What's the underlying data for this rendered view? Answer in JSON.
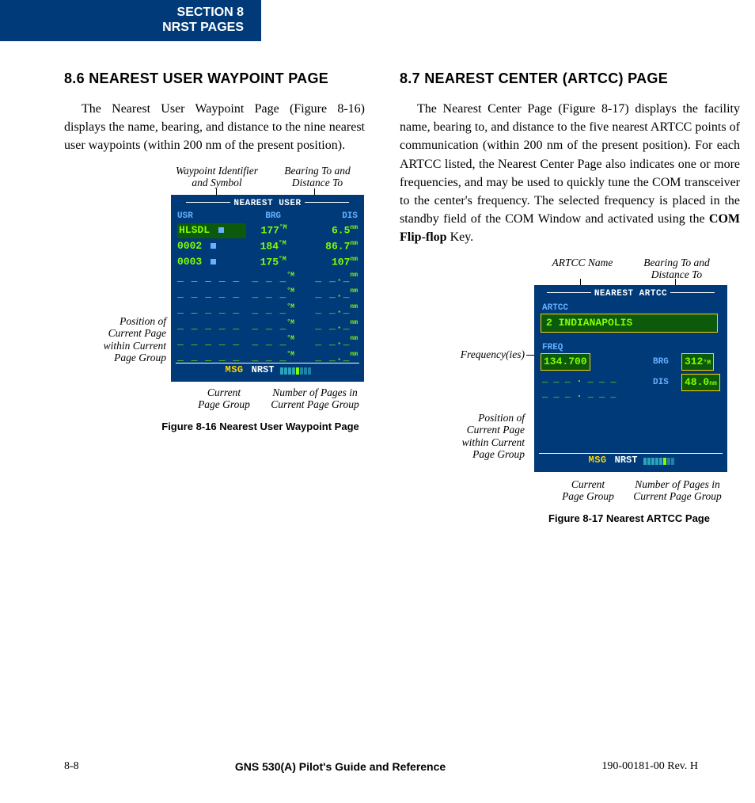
{
  "section_tab": {
    "line1": "SECTION 8",
    "line2": "NRST PAGES"
  },
  "col1": {
    "heading": "8.6  NEAREST USER WAYPOINT PAGE",
    "para": "The Nearest User Waypoint Page (Figure 8-16) displays the name, bearing, and distance to the nine nearest user waypoints (within 200 nm of the present position)."
  },
  "col2": {
    "heading": "8.7  NEAREST CENTER (ARTCC) PAGE",
    "para_a": "The Nearest Center Page (Figure 8-17) displays the facility name, bearing to, and distance to the five nearest ARTCC points of communication (within 200 nm of the present position).  For each ARTCC listed, the Nearest Center Page also indicates one or more frequencies, and may be used to quickly tune the COM transceiver to the center's frequency.  The selected frequency is placed in the standby field of the COM Window and activated using the ",
    "para_b_bold": "COM Flip-flop",
    "para_c": " Key."
  },
  "fig16": {
    "callouts": {
      "wpident": "Waypoint Identifier and Symbol",
      "brgdis": "Bearing To and Distance To",
      "pos_a": "Position of",
      "pos_b": "Current Page",
      "pos_c": "within Current",
      "pos_d": "Page Group",
      "cpg_a": "Current",
      "cpg_b": "Page Group",
      "npg_a": "Number of Pages in",
      "npg_b": "Current Page Group"
    },
    "gps": {
      "title": "NEAREST USER",
      "hdr_usr": "USR",
      "hdr_brg": "BRG",
      "hdr_dis": "DIS",
      "rows": [
        {
          "id": "HLSDL",
          "brg": "177",
          "brg_suf": "°M",
          "dis": "6.5",
          "dis_suf": "nm",
          "hl": true
        },
        {
          "id": "0002",
          "brg": "184",
          "brg_suf": "°M",
          "dis": "86.7",
          "dis_suf": "nm"
        },
        {
          "id": "0003",
          "brg": "175",
          "brg_suf": "°M",
          "dis": "107",
          "dis_suf": "nm"
        }
      ],
      "empty_id": "_ _ _ _ _",
      "empty_brg": "_ _ _",
      "empty_brg_suf": "°M",
      "empty_dis": "_ _._",
      "empty_dis_suf": "nm",
      "msg": "MSG",
      "nrst": "NRST"
    },
    "caption": "Figure 8-16  Nearest User Waypoint Page"
  },
  "fig17": {
    "callouts": {
      "artcc_name": "ARTCC Name",
      "brgdis": "Bearing To and Distance To",
      "freq": "Frequency(ies)",
      "pos_a": "Position of",
      "pos_b": "Current Page",
      "pos_c": "within Current",
      "pos_d": "Page Group",
      "cpg_a": "Current",
      "cpg_b": "Page Group",
      "npg_a": "Number of Pages in",
      "npg_b": "Current Page Group"
    },
    "gps": {
      "title": "NEAREST ARTCC",
      "artcc_lbl": "ARTCC",
      "artcc_name": "2 INDIANAPOLIS",
      "freq_lbl": "FREQ",
      "freq_val": "134.700",
      "freq_blank": "_ _ _ . _ _ _",
      "brg_lbl": "BRG",
      "brg_val": "312",
      "brg_suf": "°M",
      "dis_lbl": "DIS",
      "dis_val": "48.0",
      "dis_suf": "nm",
      "msg": "MSG",
      "nrst": "NRST"
    },
    "caption": "Figure 8-17  Nearest ARTCC Page"
  },
  "footer": {
    "left": "8-8",
    "center": "GNS 530(A) Pilot's Guide and Reference",
    "right": "190-00181-00  Rev. H"
  }
}
